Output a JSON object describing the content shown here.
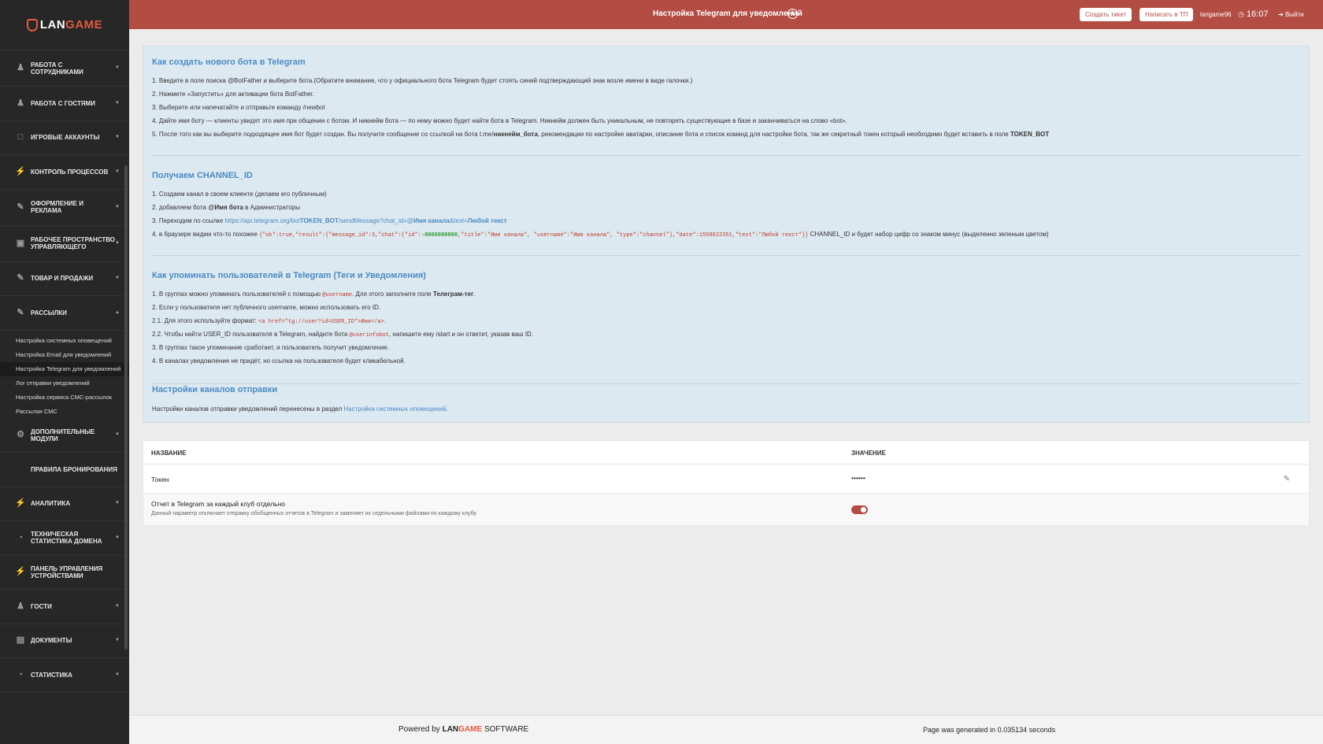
{
  "brand": {
    "logo_text_1": "LAN",
    "logo_text_2": "GAME"
  },
  "header": {
    "title": "Настройка Telegram для уведомлений",
    "create_ticket": "Создать тикет",
    "write_support": "Написать в ТП",
    "username": "langame96",
    "time": "16:07",
    "logout": "Выйти"
  },
  "sidebar": {
    "items": [
      {
        "label": "Работа с сотрудниками",
        "icon": "users-icon"
      },
      {
        "label": "Работа с гостями",
        "icon": "users-icon"
      },
      {
        "label": "Игровые аккаунты",
        "icon": "account-icon"
      },
      {
        "label": "Контроль процессов",
        "icon": "bolt-icon"
      },
      {
        "label": "Оформление и реклама",
        "icon": "edit-icon"
      },
      {
        "label": "Рабочее пространство управляющего",
        "icon": "briefcase-icon"
      },
      {
        "label": "Товар и продажи",
        "icon": "edit-icon"
      },
      {
        "label": "Рассылки",
        "icon": "edit-icon"
      }
    ],
    "subitems": [
      "Настройка системных оповещений",
      "Настройка Email для уведомлений",
      "Настройка Telegram для уведомлений",
      "Лог отправки уведомлений",
      "Настройка сервиса СМС-рассылок",
      "Рассылки СМС"
    ],
    "items2": [
      {
        "label": "Дополнительные модули",
        "icon": "gear-icon"
      },
      {
        "label": "Правила бронирования",
        "icon": ""
      },
      {
        "label": "Аналитика",
        "icon": "bolt-icon"
      },
      {
        "label": "Техническая статистика домена",
        "icon": "chart-icon"
      },
      {
        "label": "Панель управления устройствами",
        "icon": "bolt-icon"
      },
      {
        "label": "Гости",
        "icon": "users-icon"
      },
      {
        "label": "Документы",
        "icon": "document-icon"
      },
      {
        "label": "Статистика",
        "icon": "chart-icon"
      }
    ]
  },
  "info": {
    "s1": {
      "title": "Как создать нового бота в Telegram",
      "l1": "1. Введите в поле поиска @BotFather и выберите бота.(Обратите внимание, что у официального бота Telegram будет стоять синий подтверждающий знак возле имени в виде галочки.)",
      "l2": "2. Нажмите «Запустить» для активации бота BotFather.",
      "l3": "3. Выберите или напечатайте и отправьте команду /newbot",
      "l4": "4. Дайте имя боту — клиенты увидят это имя при общении с ботом. И никнейм бота — по нему можно будет найти бота в Telegram. Никнейм должен быть уникальным, не повторять существующие в базе и заканчиваться на слово «bot».",
      "l5a": "5. После того как вы выберите подходящее имя бот будет создан. Вы получите сообщение со ссылкой на бота t.me/",
      "l5b": "никнейм_бота",
      "l5c": ", рекомендации по настройке аватарки, описание бота и список команд для настройки бота, так же секретный токен который необходимо будет вставить в поле ",
      "l5d": "TOKEN_BOT"
    },
    "s2": {
      "title": "Получаем CHANNEL_ID",
      "l1": "1. Создаем канал в своем клиенте (делаем его публичным)",
      "l2a": "2. добавляем бота @",
      "l2b": "Имя бота",
      "l2c": " в Администраторы",
      "l3a": "3. Переходим по ссылке ",
      "l3b": "https://api.telegram.org/bot",
      "l3c": "TOKEN_BOT",
      "l3d": "/sendMessage?chat_id=@",
      "l3e": "Имя канала",
      "l3f": "&text=",
      "l3g": "Любой текст",
      "l4a": "4. в браузере видим что-то похожее ",
      "l4b": "{\"ok\":true,\"result\":{\"message_id\":3,\"chat\":{\"id\":",
      "l4c": "-0000000000",
      "l4d": ",\"title\":\"Имя канала\", \"username\":\"Имя канала\", \"type\":\"channel\"},\"date\":1558622351,\"text\":\"Любой текст\"}}",
      "l4e": " CHANNEL_ID и будет набор цифр со знаком минус (выделенно зеленым цветом)"
    },
    "s3": {
      "title": "Как упоминать пользователей в Telegram (Теги и Уведомления)",
      "l1a": "1. В группах можно упоминать пользователей с помощью ",
      "l1b": "@username",
      "l1c": ". Для этого заполните поле ",
      "l1d": "Телеграм-тег",
      "l1e": ".",
      "l2": "2. Если у пользователя нет публичного username, можно использовать его ID.",
      "l3a": "2.1. Для этого используйте формат: ",
      "l3b": "<a href=\"tg://user?id=USER_ID\">Имя</a>",
      "l3c": ".",
      "l4a": "2.2. Чтобы найти USER_ID пользователя в Telegram, найдите бота ",
      "l4b": "@userinfobot",
      "l4c": ", напишите ему /start и он ответит, указав ваш ID.",
      "l5": "3. В группах такое упоминание сработает, и пользователь получит уведомление.",
      "l6": "4. В каналах уведомление не придёт, но ссылка на пользователя будет кликабельной."
    },
    "s4": {
      "title": "Настройки каналов отправки",
      "l1a": "Настройки каналов отправки уведомлений перенесены в раздел ",
      "l1b": "Настройка системных оповещений",
      "l1c": "."
    }
  },
  "table": {
    "col_name": "НАЗВАНИЕ",
    "col_value": "ЗНАЧЕНИЕ",
    "rows": [
      {
        "name": "Токен",
        "value": "••••••"
      },
      {
        "name": "Отчет в Telegram за каждый клуб отдельно",
        "desc": "Данный параметр отключает отправку обобщенных отчетов в Telegram и заменяет их отдельными файлами по каждому клубу",
        "toggle_on": true
      }
    ]
  },
  "footer": {
    "powered_by": "Powered by",
    "software": "SOFTWARE",
    "generated": "Page was generated in 0.035134 seconds"
  },
  "colors": {
    "accent": "#b34d44",
    "link": "#4a8ac4",
    "sidebar": "#272727"
  }
}
